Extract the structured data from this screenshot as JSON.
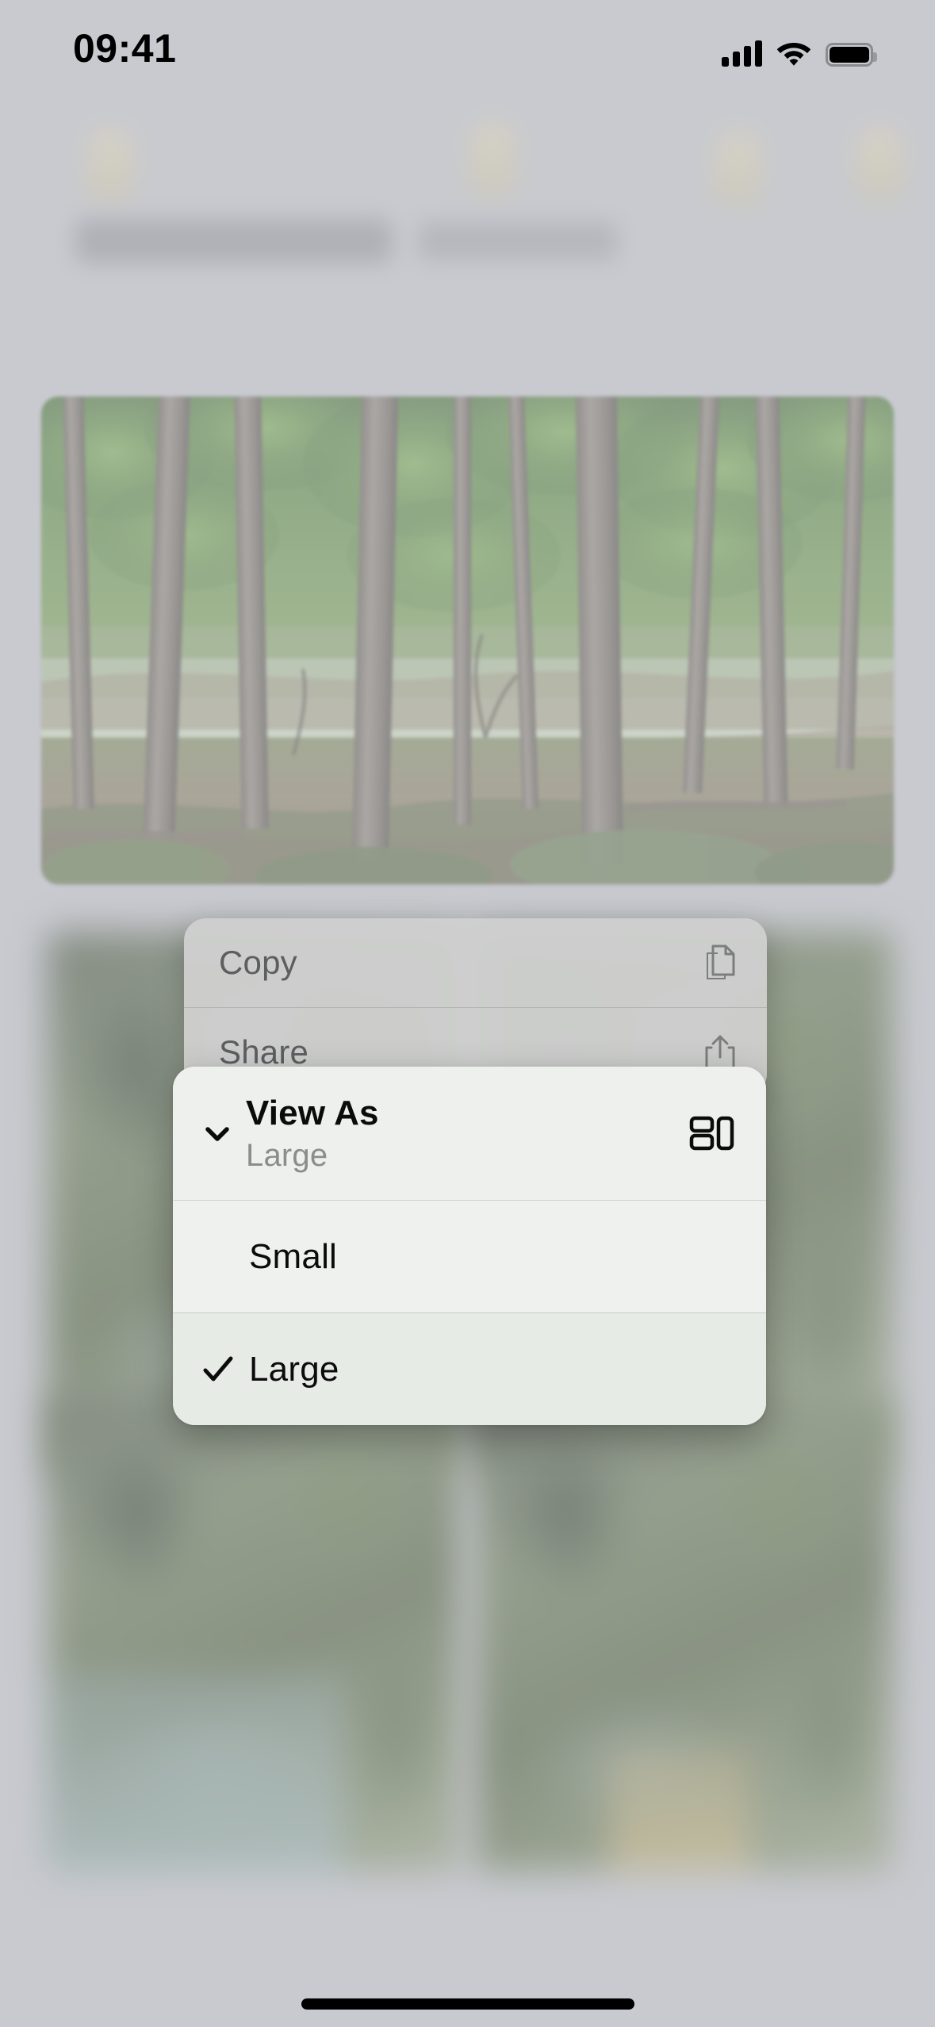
{
  "status_bar": {
    "time": "09:41",
    "cellular_icon": "cellular-signal-icon",
    "wifi_icon": "wifi-icon",
    "battery_icon": "battery-icon"
  },
  "context_menu": {
    "items": [
      {
        "label": "Copy",
        "icon": "doc-on-doc-icon"
      },
      {
        "label": "Share",
        "icon": "square-and-arrow-up-icon"
      }
    ]
  },
  "submenu": {
    "header": {
      "title": "View As",
      "subtitle": "Large",
      "back_icon": "chevron-down-icon",
      "trailing_icon": "rectangle-grid-layout-icon"
    },
    "options": [
      {
        "label": "Small",
        "selected": false,
        "check_icon": ""
      },
      {
        "label": "Large",
        "selected": true,
        "check_icon": "checkmark-icon"
      }
    ]
  },
  "home_indicator": {
    "name": "home-indicator"
  },
  "colors": {
    "page_background": "#c9cad0",
    "submenu_background": "#eef0ed",
    "submenu_selected_row": "#e7ebe6",
    "context_menu_background": "#cecfce",
    "primary_text": "#0b0b0b",
    "secondary_text": "#8b8d8b",
    "dimmed_text": "#5d5e60"
  }
}
